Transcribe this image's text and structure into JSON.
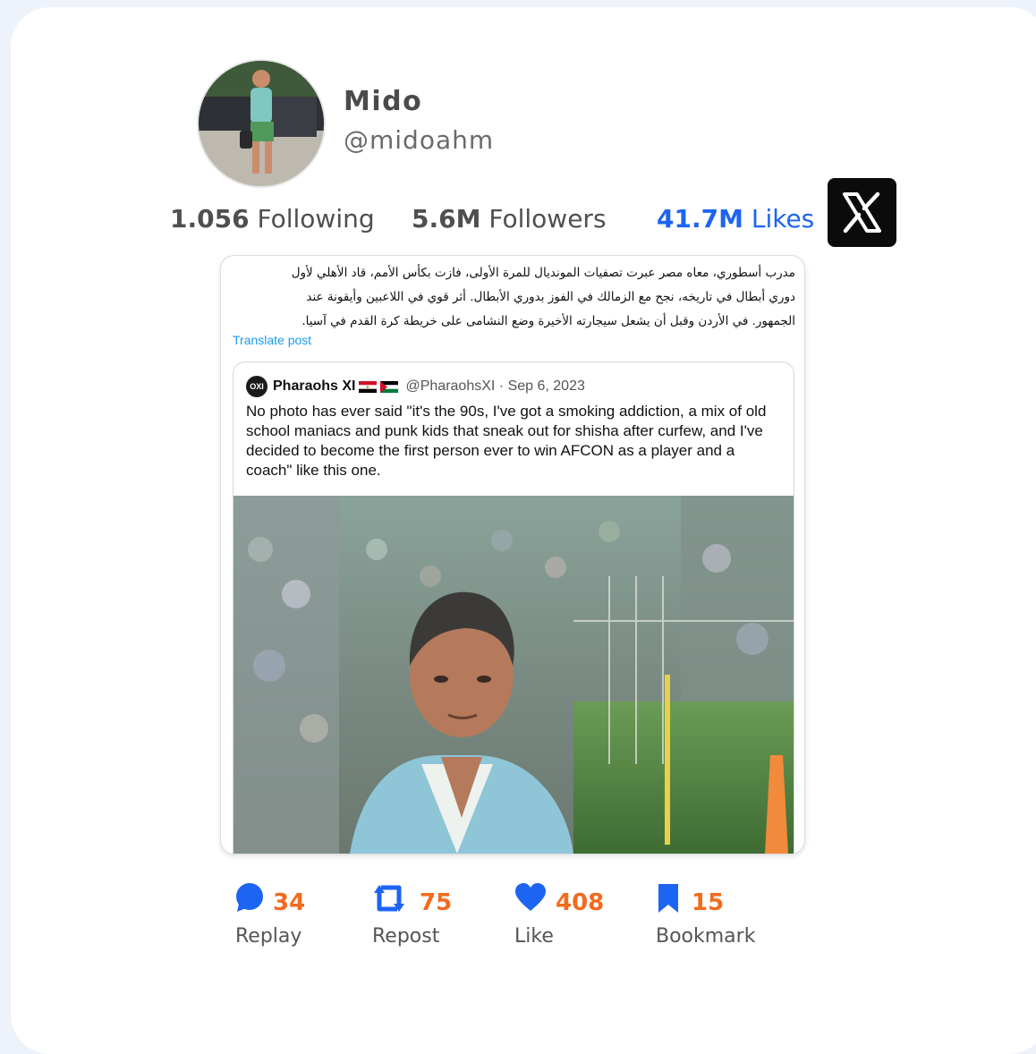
{
  "profile": {
    "name": "Mido",
    "handle": "@midoahm",
    "following_count": "1.056",
    "following_label": "Following",
    "followers_count": "5.6M",
    "followers_label": "Followers",
    "likes_count": "41.7M",
    "likes_label": "Likes"
  },
  "platform": {
    "logo": "X",
    "icon": "x-logo-icon"
  },
  "post": {
    "text_lines": [
      "مدرب أسطوري، معاه مصر عبرت تصفيات المونديال للمرة الأولى، فازت بكأس الأمم، قاد الأهلي لأول",
      "دوري أبطال في تاريخه، نجح مع الزمالك في الفوز بدوري الأبطال. أثر قوي في اللاعبين وأيقونة عند",
      "الجمهور. في الأردن وقبل أن يشعل سيجارته الأخيرة وضع النشامى على خريطة كرة القدم في آسيا."
    ],
    "translate_label": "Translate post"
  },
  "quote": {
    "avatar_text": "OXI",
    "name": "Pharaohs XI",
    "handle": "@PharaohsXI",
    "separator": "·",
    "date": "Sep 6, 2023",
    "text": "No photo has ever said \"it's the 90s, I've got a smoking addiction, a mix of old school maniacs and punk kids that sneak out for shisha after curfew, and I've decided to become the first person ever to win AFCON as a player and a coach\" like this one."
  },
  "actions": [
    {
      "icon": "comment-icon",
      "count": "34",
      "label": "Replay"
    },
    {
      "icon": "repost-icon",
      "count": "75",
      "label": "Repost"
    },
    {
      "icon": "heart-icon",
      "count": "408",
      "label": "Like"
    },
    {
      "icon": "bookmark-icon",
      "count": "15",
      "label": "Bookmark"
    }
  ],
  "colors": {
    "accent_blue": "#1d64f2",
    "count_orange": "#f26b1d",
    "translate_blue": "#1d9bf0"
  }
}
